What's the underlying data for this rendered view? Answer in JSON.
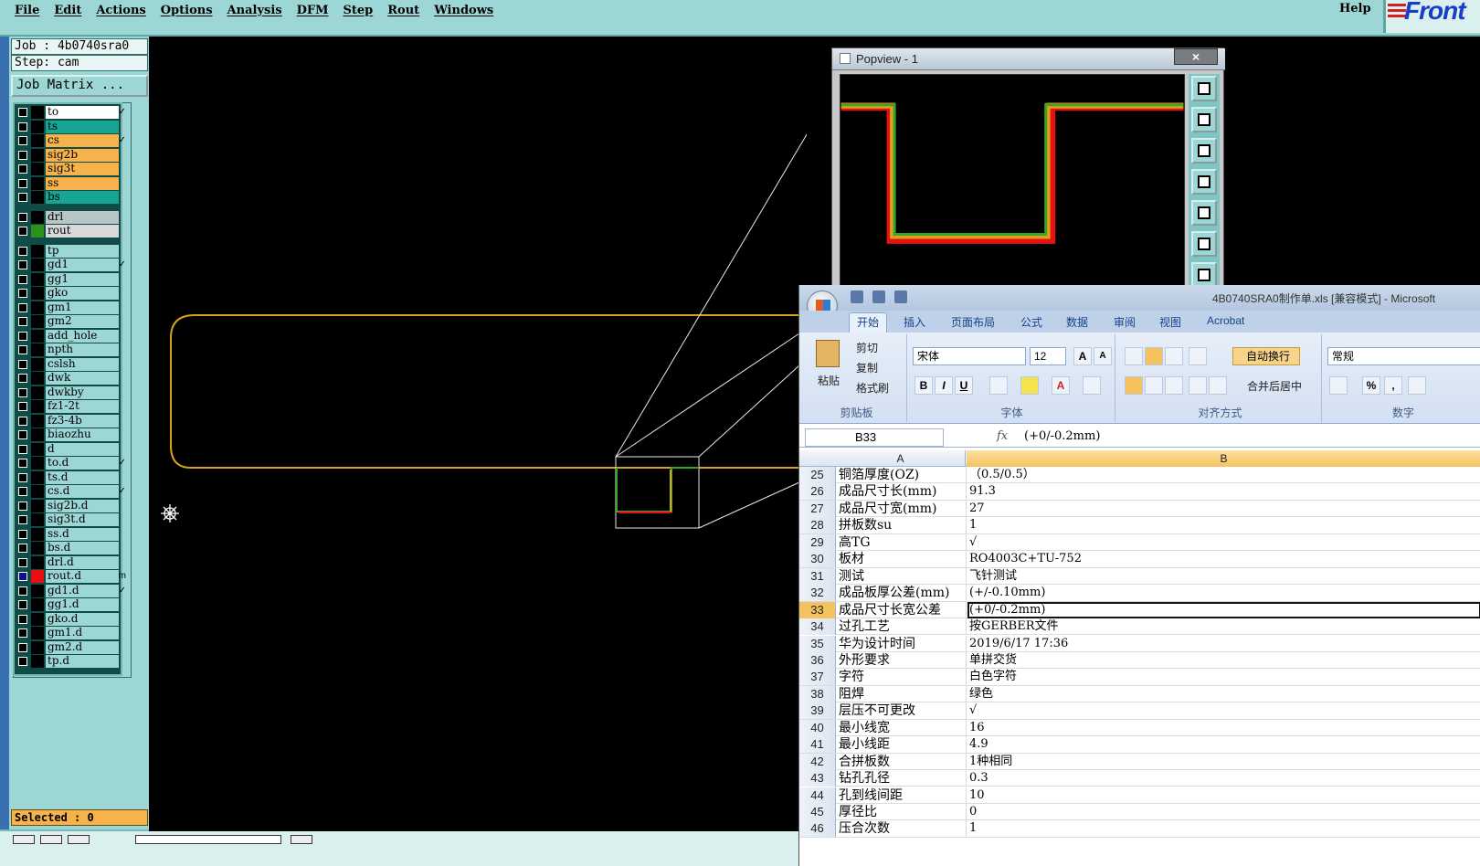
{
  "menu": {
    "items": [
      "File",
      "Edit",
      "Actions",
      "Options",
      "Analysis",
      "DFM",
      "Step",
      "Rout",
      "Windows"
    ],
    "help": "Help",
    "logo": "Front"
  },
  "job": {
    "job_label": "Job : 4b0740sra0",
    "step_label": "Step: cam",
    "matrix_button": "Job Matrix ...",
    "selected": "Selected : 0"
  },
  "layers": [
    {
      "name": "to",
      "color": "#ffffff",
      "swatch": "#000000",
      "mark": "✓",
      "checked": false
    },
    {
      "name": "ts",
      "color": "#17a594",
      "swatch": "#000000",
      "mark": "",
      "checked": false
    },
    {
      "name": "cs",
      "color": "#f6b24b",
      "swatch": "#000000",
      "mark": "✓",
      "checked": false
    },
    {
      "name": "sig2b",
      "color": "#f6b24b",
      "swatch": "#000000",
      "mark": "",
      "checked": false
    },
    {
      "name": "sig3t",
      "color": "#f6b24b",
      "swatch": "#000000",
      "mark": "",
      "checked": false
    },
    {
      "name": "ss",
      "color": "#f6b24b",
      "swatch": "#000000",
      "mark": "",
      "checked": false
    },
    {
      "name": "bs",
      "color": "#17a594",
      "swatch": "#000000",
      "mark": "",
      "checked": false
    },
    {
      "name": "drl",
      "color": "#b9c6c6",
      "swatch": "#000000",
      "mark": "",
      "checked": false
    },
    {
      "name": "rout",
      "color": "#d9d9d9",
      "swatch": "#2f8f1f",
      "mark": "",
      "checked": false
    },
    {
      "name": "tp",
      "color": "#9dd7d5",
      "swatch": "#000000",
      "mark": "",
      "checked": false
    },
    {
      "name": "gd1",
      "color": "#9dd7d5",
      "swatch": "#000000",
      "mark": "✓",
      "checked": false
    },
    {
      "name": "gg1",
      "color": "#9dd7d5",
      "swatch": "#000000",
      "mark": "",
      "checked": false
    },
    {
      "name": "gko",
      "color": "#9dd7d5",
      "swatch": "#000000",
      "mark": "",
      "checked": false
    },
    {
      "name": "gm1",
      "color": "#9dd7d5",
      "swatch": "#000000",
      "mark": "",
      "checked": false
    },
    {
      "name": "gm2",
      "color": "#9dd7d5",
      "swatch": "#000000",
      "mark": "",
      "checked": false
    },
    {
      "name": "add_hole",
      "color": "#9dd7d5",
      "swatch": "#000000",
      "mark": "",
      "checked": false
    },
    {
      "name": "npth",
      "color": "#9dd7d5",
      "swatch": "#000000",
      "mark": "",
      "checked": false
    },
    {
      "name": "cslsh",
      "color": "#9dd7d5",
      "swatch": "#000000",
      "mark": "",
      "checked": false
    },
    {
      "name": "dwk",
      "color": "#9dd7d5",
      "swatch": "#000000",
      "mark": "",
      "checked": false
    },
    {
      "name": "dwkby",
      "color": "#9dd7d5",
      "swatch": "#000000",
      "mark": "",
      "checked": false
    },
    {
      "name": "fz1-2t",
      "color": "#9dd7d5",
      "swatch": "#000000",
      "mark": "",
      "checked": false
    },
    {
      "name": "fz3-4b",
      "color": "#9dd7d5",
      "swatch": "#000000",
      "mark": "",
      "checked": false
    },
    {
      "name": "biaozhu",
      "color": "#9dd7d5",
      "swatch": "#000000",
      "mark": "",
      "checked": false
    },
    {
      "name": "d",
      "color": "#9dd7d5",
      "swatch": "#000000",
      "mark": "",
      "checked": false
    },
    {
      "name": "to.d",
      "color": "#9dd7d5",
      "swatch": "#000000",
      "mark": "✓",
      "checked": false
    },
    {
      "name": "ts.d",
      "color": "#9dd7d5",
      "swatch": "#000000",
      "mark": "",
      "checked": false
    },
    {
      "name": "cs.d",
      "color": "#9dd7d5",
      "swatch": "#000000",
      "mark": "✓",
      "checked": false
    },
    {
      "name": "sig2b.d",
      "color": "#9dd7d5",
      "swatch": "#000000",
      "mark": "",
      "checked": false
    },
    {
      "name": "sig3t.d",
      "color": "#9dd7d5",
      "swatch": "#000000",
      "mark": "",
      "checked": false
    },
    {
      "name": "ss.d",
      "color": "#9dd7d5",
      "swatch": "#000000",
      "mark": "",
      "checked": false
    },
    {
      "name": "bs.d",
      "color": "#9dd7d5",
      "swatch": "#000000",
      "mark": "",
      "checked": false
    },
    {
      "name": "drl.d",
      "color": "#9dd7d5",
      "swatch": "#000000",
      "mark": "",
      "checked": false
    },
    {
      "name": "rout.d",
      "color": "#9dd7d5",
      "swatch": "#e81010",
      "mark": "m",
      "checked": true
    },
    {
      "name": "gd1.d",
      "color": "#9dd7d5",
      "swatch": "#000000",
      "mark": "✓",
      "checked": false
    },
    {
      "name": "gg1.d",
      "color": "#9dd7d5",
      "swatch": "#000000",
      "mark": "",
      "checked": false
    },
    {
      "name": "gko.d",
      "color": "#9dd7d5",
      "swatch": "#000000",
      "mark": "",
      "checked": false
    },
    {
      "name": "gm1.d",
      "color": "#9dd7d5",
      "swatch": "#000000",
      "mark": "",
      "checked": false
    },
    {
      "name": "gm2.d",
      "color": "#9dd7d5",
      "swatch": "#000000",
      "mark": "",
      "checked": false
    },
    {
      "name": "tp.d",
      "color": "#9dd7d5",
      "swatch": "#000000",
      "mark": "",
      "checked": false
    }
  ],
  "popview": {
    "title": "Popview - 1",
    "close": "×"
  },
  "excel": {
    "title": "4B0740SRA0制作单.xls  [兼容模式] - Microsoft",
    "tabs": [
      "开始",
      "插入",
      "页面布局",
      "公式",
      "数据",
      "审阅",
      "视图",
      "Acrobat"
    ],
    "clipboard": {
      "paste": "粘贴",
      "cut": "剪切",
      "copy": "复制",
      "format_painter": "格式刷",
      "group": "剪贴板"
    },
    "font": {
      "name": "宋体",
      "size": "12",
      "group": "字体",
      "bold": "B",
      "italic": "I",
      "underline": "U"
    },
    "alignment": {
      "wrap": "自动换行",
      "merge": "合并后居中",
      "group": "对齐方式"
    },
    "number": {
      "format": "常规",
      "group": "数字",
      "percent": "%"
    },
    "namebox": "B33",
    "fx": "fx",
    "formula": "(+0/-0.2mm)",
    "col_a": "A",
    "col_b": "B",
    "selected_row": 33,
    "rows": [
      {
        "n": 25,
        "a": "铜箔厚度(OZ)",
        "b": "（0.5/0.5）"
      },
      {
        "n": 26,
        "a": "成品尺寸长(mm)",
        "b": "91.3"
      },
      {
        "n": 27,
        "a": "成品尺寸宽(mm)",
        "b": "27"
      },
      {
        "n": 28,
        "a": "拼板数su",
        "b": "1"
      },
      {
        "n": 29,
        "a": "高TG",
        "b": "√"
      },
      {
        "n": 30,
        "a": "板材",
        "b": "RO4003C+TU-752"
      },
      {
        "n": 31,
        "a": "测试",
        "b": "飞针测试"
      },
      {
        "n": 32,
        "a": "成品板厚公差(mm)",
        "b": "(+/-0.10mm)"
      },
      {
        "n": 33,
        "a": "成品尺寸长宽公差",
        "b": "(+0/-0.2mm)"
      },
      {
        "n": 34,
        "a": "过孔工艺",
        "b": "按GERBER文件"
      },
      {
        "n": 35,
        "a": "华为设计时间",
        "b": "2019/6/17 17:36"
      },
      {
        "n": 36,
        "a": "外形要求",
        "b": "单拼交货"
      },
      {
        "n": 37,
        "a": "字符",
        "b": "白色字符"
      },
      {
        "n": 38,
        "a": "阻焊",
        "b": "绿色"
      },
      {
        "n": 39,
        "a": "层压不可更改",
        "b": "√"
      },
      {
        "n": 40,
        "a": "最小线宽",
        "b": "16"
      },
      {
        "n": 41,
        "a": "最小线距",
        "b": "4.9"
      },
      {
        "n": 42,
        "a": "合拼板数",
        "b": "1种相同"
      },
      {
        "n": 43,
        "a": "钻孔孔径",
        "b": "0.3"
      },
      {
        "n": 44,
        "a": "孔到线间距",
        "b": "10"
      },
      {
        "n": 45,
        "a": "厚径比",
        "b": "0"
      },
      {
        "n": 46,
        "a": "压合次数",
        "b": "1"
      }
    ]
  },
  "colors": {
    "outline": "#d9a21a",
    "outline_green": "#3aa52a",
    "rout_red": "#e81010"
  }
}
